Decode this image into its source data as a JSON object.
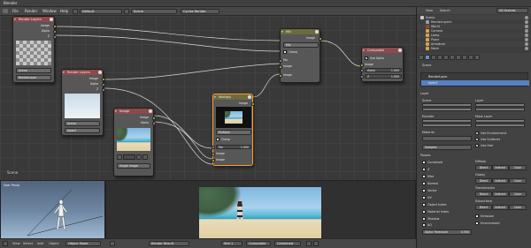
{
  "app": {
    "title": "Blender"
  },
  "menubar": {
    "items": [
      "File",
      "Render",
      "Window",
      "Help"
    ],
    "layout_field": "Default",
    "scene_field": "Scene",
    "engine_field": "Cycles Render",
    "info": ""
  },
  "node_editor": {
    "bottom_label": "Scene",
    "nodes": {
      "render_layers_1": {
        "title": "Render Layers",
        "outputs": [
          "Image",
          "Alpha",
          "Z"
        ],
        "scene": "Scene",
        "layer": "RenderLayer"
      },
      "render_layers_2": {
        "title": "Render Layers",
        "outputs": [
          "Image",
          "Alpha",
          "Z"
        ],
        "scene": "Scene",
        "layer": "layer2"
      },
      "image": {
        "title": "Image",
        "outputs": [
          "Image",
          "Alpha"
        ],
        "source": "Single Image"
      },
      "multiply": {
        "title": "Multiply",
        "output": "Image",
        "blend": "Multiply",
        "clamp_label": "Clamp",
        "fac_label": "Fac",
        "fac_value": "1.000",
        "inputs": [
          "Image",
          "Image"
        ]
      },
      "mix": {
        "title": "Mix",
        "output": "Image",
        "blend": "Mix",
        "clamp_label": "Clamp",
        "fac_label": "Fac",
        "inputs": [
          "Image",
          "Image"
        ]
      },
      "composite": {
        "title": "Composite",
        "use_alpha_label": "Use Alpha",
        "inputs": [
          "Image",
          "Alpha",
          "Z"
        ],
        "alpha_value": "1.000",
        "z_value": "1.000"
      }
    }
  },
  "viewport": {
    "title": "User Persp",
    "bottom_label": ""
  },
  "image_editor": {
    "frame_info": ""
  },
  "bottombar": {
    "items": [
      "View",
      "Select",
      "Add",
      "Object",
      "Object Mode",
      "Render Result",
      "Slot 1",
      "Composite",
      "Combined"
    ]
  },
  "outliner": {
    "header_items": [
      "View",
      "Search",
      "All Scenes"
    ],
    "rows": [
      "Scene",
      "RenderLayers",
      "World",
      "Camera",
      "Lamp",
      "Plane",
      "Armature",
      "Mesh"
    ]
  },
  "properties": {
    "scene_label": "Scene",
    "layer_list": [
      "RenderLayer",
      "layer2"
    ],
    "layer_section": "Layer",
    "labels": {
      "scene": "Scene",
      "layer": "Layer",
      "exclude": "Exclude",
      "mask_layer": "Mask Layer",
      "material": "Material",
      "use_environment": "Use Environment",
      "use_surfaces": "Use Surfaces",
      "use_hair": "Use Hair",
      "samples": "Samples",
      "passes": "Passes",
      "combined": "Combined",
      "z": "Z",
      "mist": "Mist",
      "normal": "Normal",
      "vector": "Vector",
      "uv": "UV",
      "object_index": "Object Index",
      "material_index": "Material Index",
      "shadow": "Shadow",
      "ao": "AO",
      "diffuse": "Diffuse",
      "glossy": "Glossy",
      "transmission": "Transmission",
      "subsurface": "Subsurface",
      "emission": "Emission",
      "environment": "Environment",
      "alpha_threshold": "Alpha Threshold",
      "alpha_threshold_value": "0.500",
      "direct": "Direct",
      "indirect": "Indirect",
      "color": "Color"
    }
  }
}
